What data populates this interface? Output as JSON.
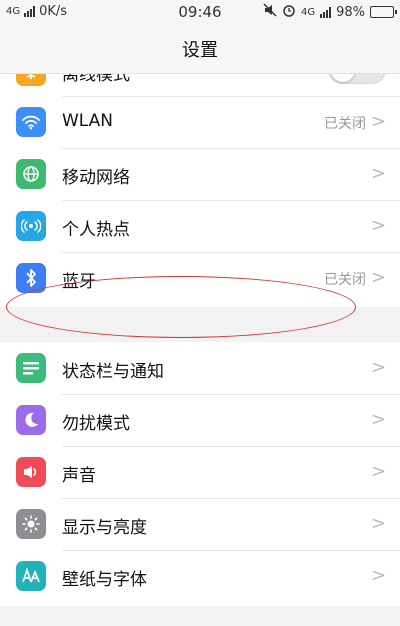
{
  "status_bar": {
    "network": "4G",
    "speed": "0K/s",
    "time": "09:46",
    "network_right": "4G",
    "battery": "98%"
  },
  "header": {
    "title": "设置"
  },
  "settings": {
    "group1": [
      {
        "label": "离线模式",
        "icon": "airplane-icon",
        "color": "#f5a623",
        "control": "toggle",
        "toggle_on": false
      },
      {
        "label": "WLAN",
        "icon": "wifi-icon",
        "color": "#3d8ef5",
        "value": "已关闭"
      },
      {
        "label": "移动网络",
        "icon": "globe-icon",
        "color": "#3dba6f",
        "value": ""
      },
      {
        "label": "个人热点",
        "icon": "hotspot-icon",
        "color": "#27a6e6",
        "value": ""
      },
      {
        "label": "蓝牙",
        "icon": "bluetooth-icon",
        "color": "#3d7ef5",
        "value": "已关闭"
      }
    ],
    "group2": [
      {
        "label": "状态栏与通知",
        "icon": "notification-icon",
        "color": "#3cbb7c"
      },
      {
        "label": "勿扰模式",
        "icon": "moon-icon",
        "color": "#9b6be8"
      },
      {
        "label": "声音",
        "icon": "speaker-icon",
        "color": "#f04b57"
      },
      {
        "label": "显示与亮度",
        "icon": "brightness-icon",
        "color": "#8e8e93"
      },
      {
        "label": "壁纸与字体",
        "icon": "font-icon",
        "color": "#22b3b8"
      }
    ]
  },
  "chevron": ">"
}
